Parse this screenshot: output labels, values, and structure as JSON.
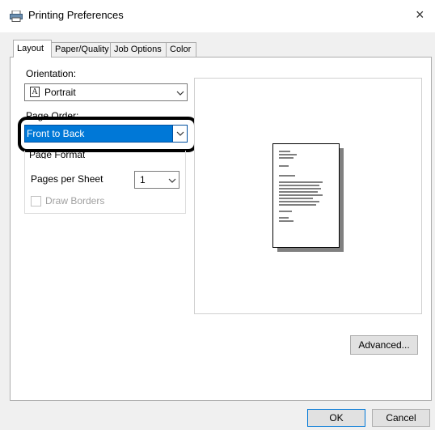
{
  "window": {
    "title": "Printing Preferences",
    "close_symbol": "×"
  },
  "tabs": [
    "Layout",
    "Paper/Quality",
    "Job Options",
    "Color"
  ],
  "layout": {
    "orientation_label": "Orientation:",
    "orientation_value": "Portrait",
    "orientation_icon_text": "A",
    "page_order_label": "Page Order:",
    "page_order_value": "Front to Back",
    "page_format_label": "Page Format",
    "pages_per_sheet_label": "Pages per Sheet",
    "pages_per_sheet_value": "1",
    "draw_borders_label": "Draw Borders"
  },
  "buttons": {
    "advanced": "Advanced...",
    "ok": "OK",
    "cancel": "Cancel"
  },
  "colors": {
    "selection": "#0078d7",
    "highlight_border": "#000000"
  }
}
